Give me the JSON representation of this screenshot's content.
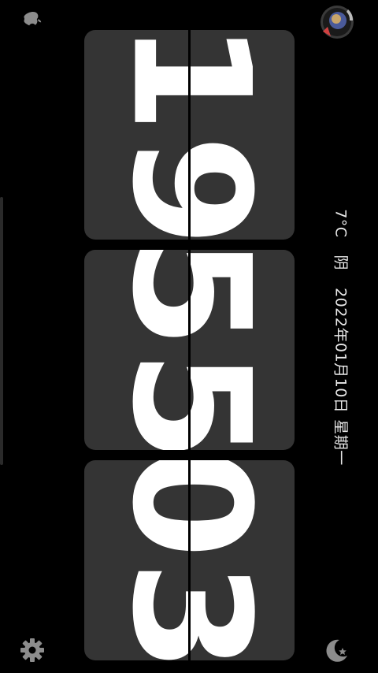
{
  "clock": {
    "hours": "19",
    "minutes": "55",
    "seconds": "03"
  },
  "info": {
    "temperature": "7°C",
    "weather": "阴",
    "date": "2022年01月10日",
    "weekday": "星期一"
  },
  "icons": {
    "top_left": "apple-icon",
    "top_right": "avatar-icon",
    "bottom_left": "gear-icon",
    "bottom_right": "moon-star-icon"
  },
  "colors": {
    "background": "#000000",
    "card": "#343434",
    "digit": "#ffffff",
    "icon": "#8c8c8c"
  }
}
